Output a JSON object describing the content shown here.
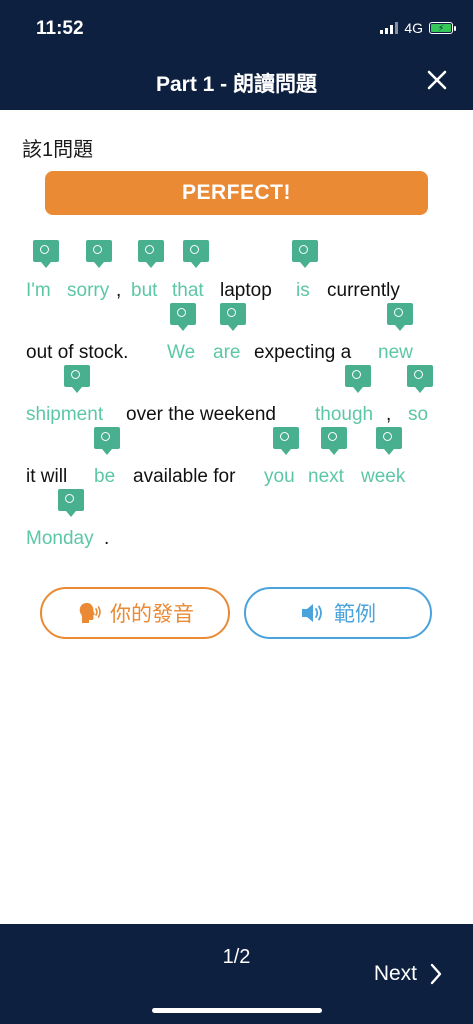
{
  "status": {
    "time": "11:52",
    "network": "4G"
  },
  "header": {
    "title": "Part 1 - 朗讀問題"
  },
  "question": {
    "label": "該1問題"
  },
  "result": {
    "label": "PERFECT!"
  },
  "passage": {
    "lines": [
      [
        "I'm",
        "sorry",
        ",",
        "but",
        "that",
        "laptop",
        "is",
        "currently"
      ],
      [
        "out of stock.",
        "We",
        "are",
        "expecting a",
        "new"
      ],
      [
        "shipment",
        "over the weekend",
        "though",
        ",",
        "so"
      ],
      [
        "it will",
        "be",
        "available for",
        "you",
        "next",
        "week"
      ],
      [
        "Monday",
        "."
      ]
    ]
  },
  "buttons": {
    "your_voice": "你的發音",
    "example": "範例"
  },
  "footer": {
    "page": "1/2",
    "next": "Next"
  },
  "colors": {
    "header": "#0e2040",
    "accent_orange": "#ea8a34",
    "correct_word": "#5cc7a6",
    "pin": "#49b08f",
    "example_blue": "#4aa3db"
  }
}
